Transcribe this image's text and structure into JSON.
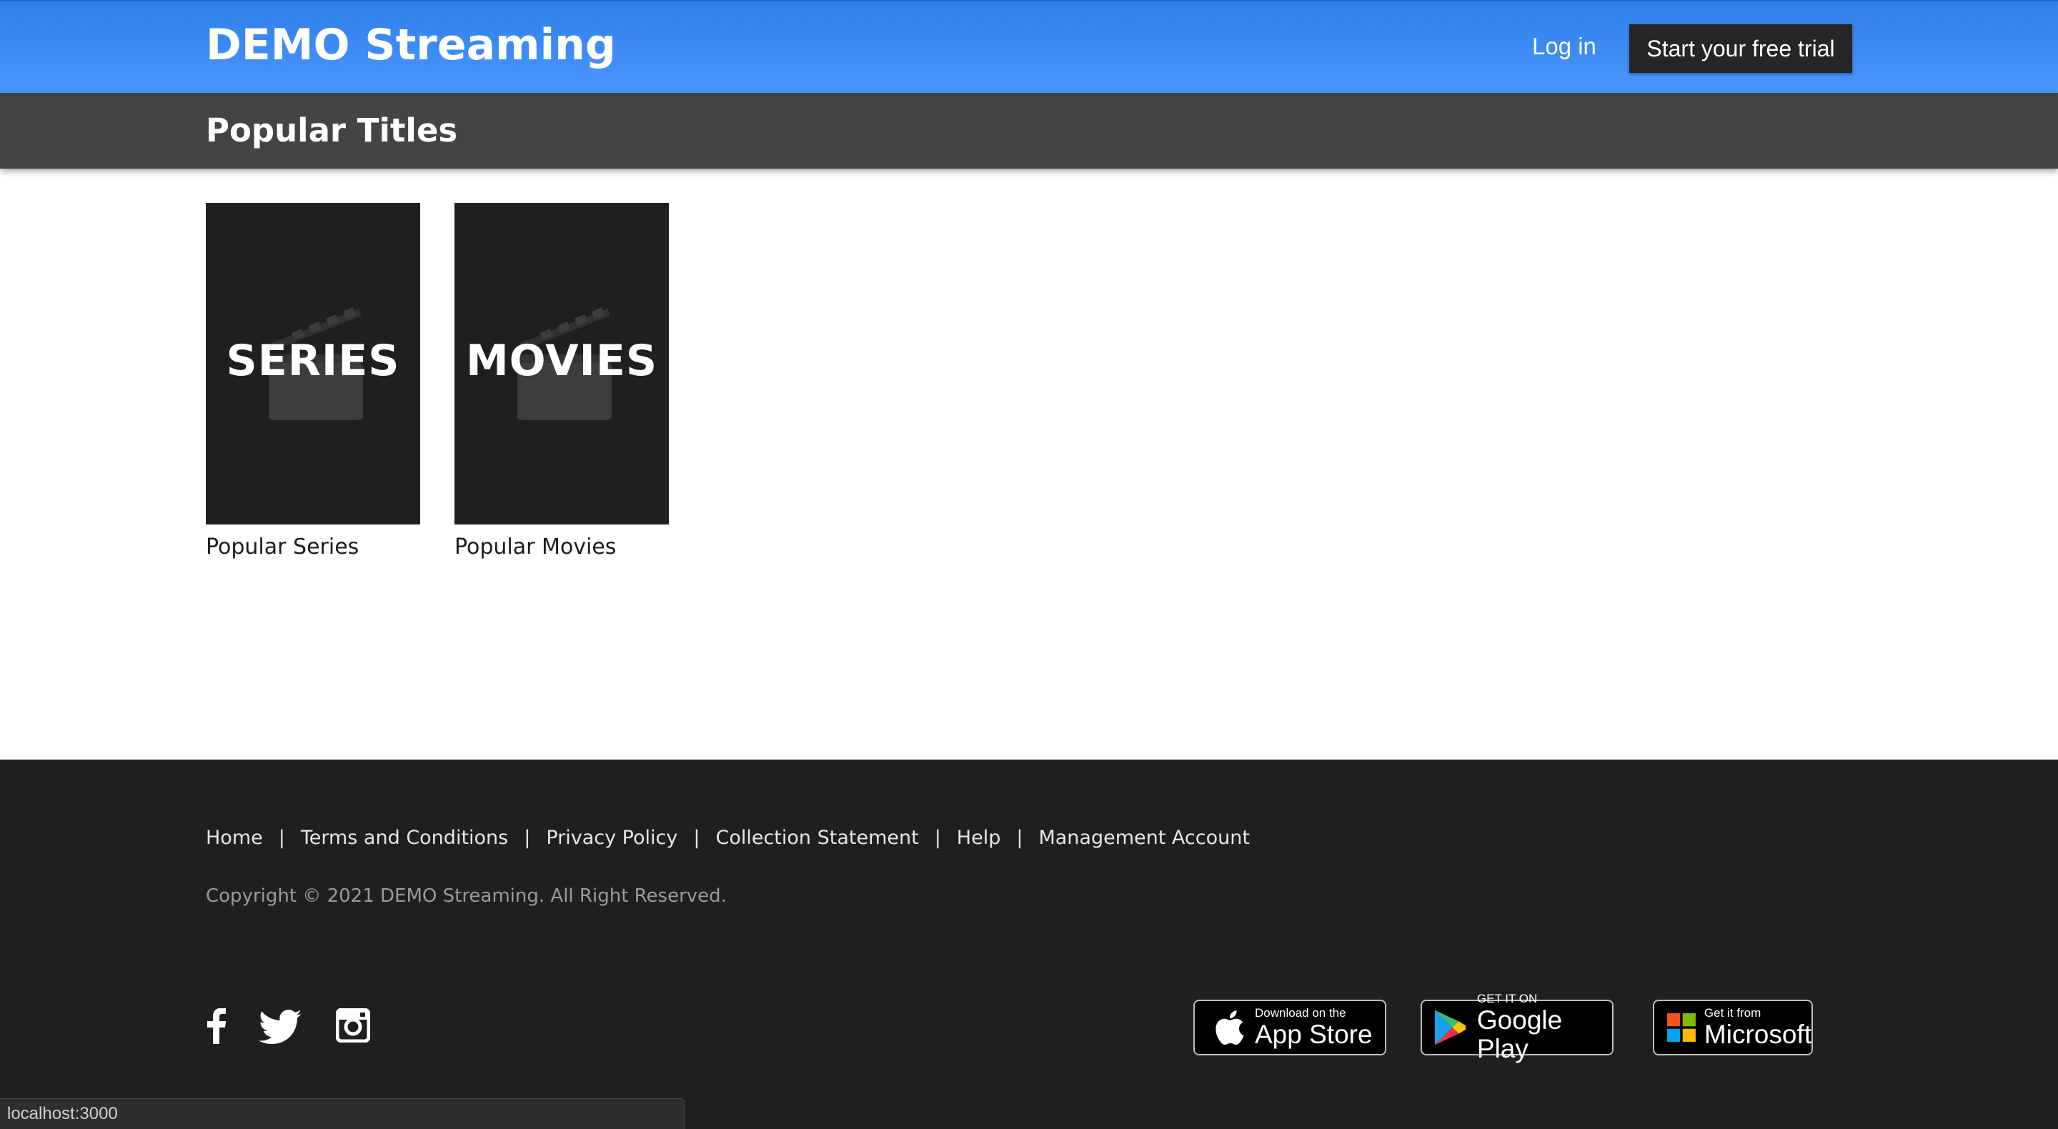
{
  "header": {
    "brand": "DEMO Streaming",
    "login_label": "Log in",
    "trial_label": "Start your free trial"
  },
  "subheader": {
    "title": "Popular Titles"
  },
  "cards": [
    {
      "tile_label": "SERIES",
      "caption": "Popular Series"
    },
    {
      "tile_label": "MOVIES",
      "caption": "Popular Movies"
    }
  ],
  "footer": {
    "links": [
      "Home",
      "Terms and Conditions",
      "Privacy Policy",
      "Collection Statement",
      "Help",
      "Management Account"
    ],
    "separator": "|",
    "copyright": "Copyright © 2021 DEMO Streaming. All Right Reserved.",
    "social": [
      "facebook-icon",
      "twitter-icon",
      "instagram-icon"
    ],
    "badges": {
      "app_store": {
        "small": "Download on the",
        "big": "App Store"
      },
      "google_play": {
        "small": "GET IT ON",
        "big": "Google Play"
      },
      "microsoft": {
        "small": "Get it from",
        "big": "Microsoft"
      }
    }
  },
  "statusbar": {
    "url": "localhost:3000"
  },
  "colors": {
    "header_blue": "#3b8cf6",
    "subheader_gray": "#444444",
    "footer_dark": "#1f1f1f",
    "tile_dark": "#1f1f1f"
  }
}
